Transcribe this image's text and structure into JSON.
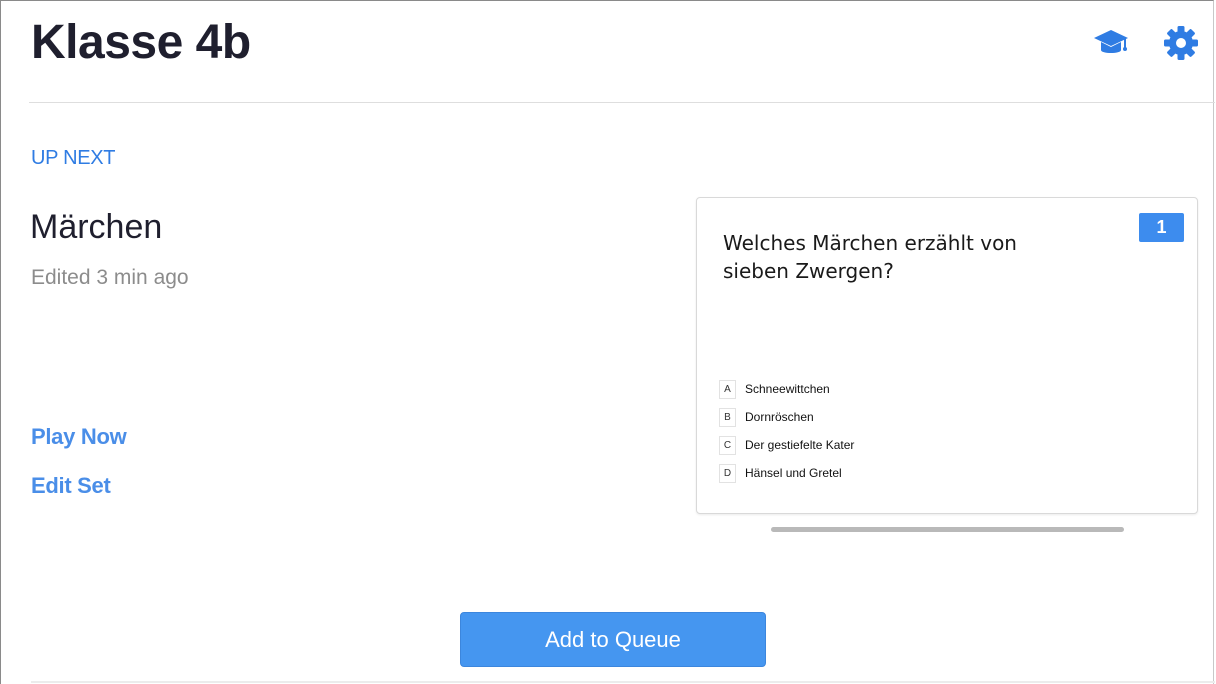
{
  "header": {
    "class_name": "Klasse 4b",
    "icons": [
      "graduation-cap-icon",
      "gear-icon"
    ]
  },
  "colors": {
    "accent": "#2f7ce3",
    "link": "#4a8ee8",
    "button": "#4596f0",
    "badge": "#3d8cee"
  },
  "up_next": {
    "label": "UP NEXT",
    "set_title": "Märchen",
    "edited": "Edited 3 min ago",
    "play_now": "Play Now",
    "edit_set": "Edit Set"
  },
  "preview": {
    "number": "1",
    "question": "Welches Märchen erzählt von sieben Zwergen?",
    "answers": [
      {
        "letter": "A",
        "text": "Schneewittchen"
      },
      {
        "letter": "B",
        "text": "Dornröschen"
      },
      {
        "letter": "C",
        "text": "Der gestiefelte Kater"
      },
      {
        "letter": "D",
        "text": "Hänsel und Gretel"
      }
    ]
  },
  "add_to_queue": "Add to Queue"
}
